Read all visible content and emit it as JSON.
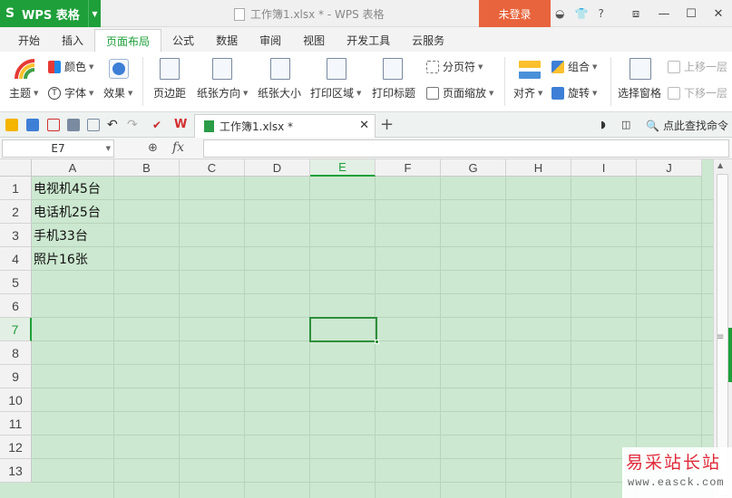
{
  "titlebar": {
    "app_name": "WPS 表格",
    "window_title": "工作簿1.xlsx * - WPS 表格",
    "login_label": "未登录",
    "icons": [
      "skin-icon",
      "shirt-icon",
      "help-icon",
      "restore-icon",
      "minimize-icon",
      "maximize-icon",
      "close-icon"
    ]
  },
  "ribbon_tabs": [
    "开始",
    "插入",
    "页面布局",
    "公式",
    "数据",
    "审阅",
    "视图",
    "开发工具",
    "云服务"
  ],
  "active_tab": "页面布局",
  "ribbon": {
    "theme_label": "主题",
    "colors_label": "颜色",
    "fonts_label": "字体",
    "effects_label": "效果",
    "margins_label": "页边距",
    "orientation_label": "纸张方向",
    "size_label": "纸张大小",
    "print_area_label": "打印区域",
    "print_titles_label": "打印标题",
    "page_break_label": "分页符",
    "page_zoom_label": "页面缩放",
    "align_label": "对齐",
    "group_label": "组合",
    "rotate_label": "旋转",
    "selection_pane_label": "选择窗格",
    "bring_forward_label": "上移一层",
    "send_backward_label": "下移一层"
  },
  "doc_tab": {
    "name": "工作簿1.xlsx *"
  },
  "find_command": "点此查找命令",
  "formula_bar": {
    "name_box": "E7",
    "fx_label": "fx",
    "formula": ""
  },
  "grid": {
    "columns": [
      "A",
      "B",
      "C",
      "D",
      "E",
      "F",
      "G",
      "H",
      "I",
      "J"
    ],
    "rows": [
      "1",
      "2",
      "3",
      "4",
      "5",
      "6",
      "7",
      "8",
      "9",
      "10",
      "11",
      "12",
      "13"
    ],
    "selected_column": "E",
    "selected_row": "7",
    "cells": {
      "A1": "电视机45台",
      "A2": "电话机25台",
      "A3": "手机33台",
      "A4": "照片16张"
    }
  },
  "watermark": {
    "text": "易采站长站",
    "url": "www.easck.com"
  },
  "colors": {
    "brand_green": "#1e9f3a",
    "login_orange": "#e8643c",
    "sheet_tint": "#cce8d0"
  }
}
